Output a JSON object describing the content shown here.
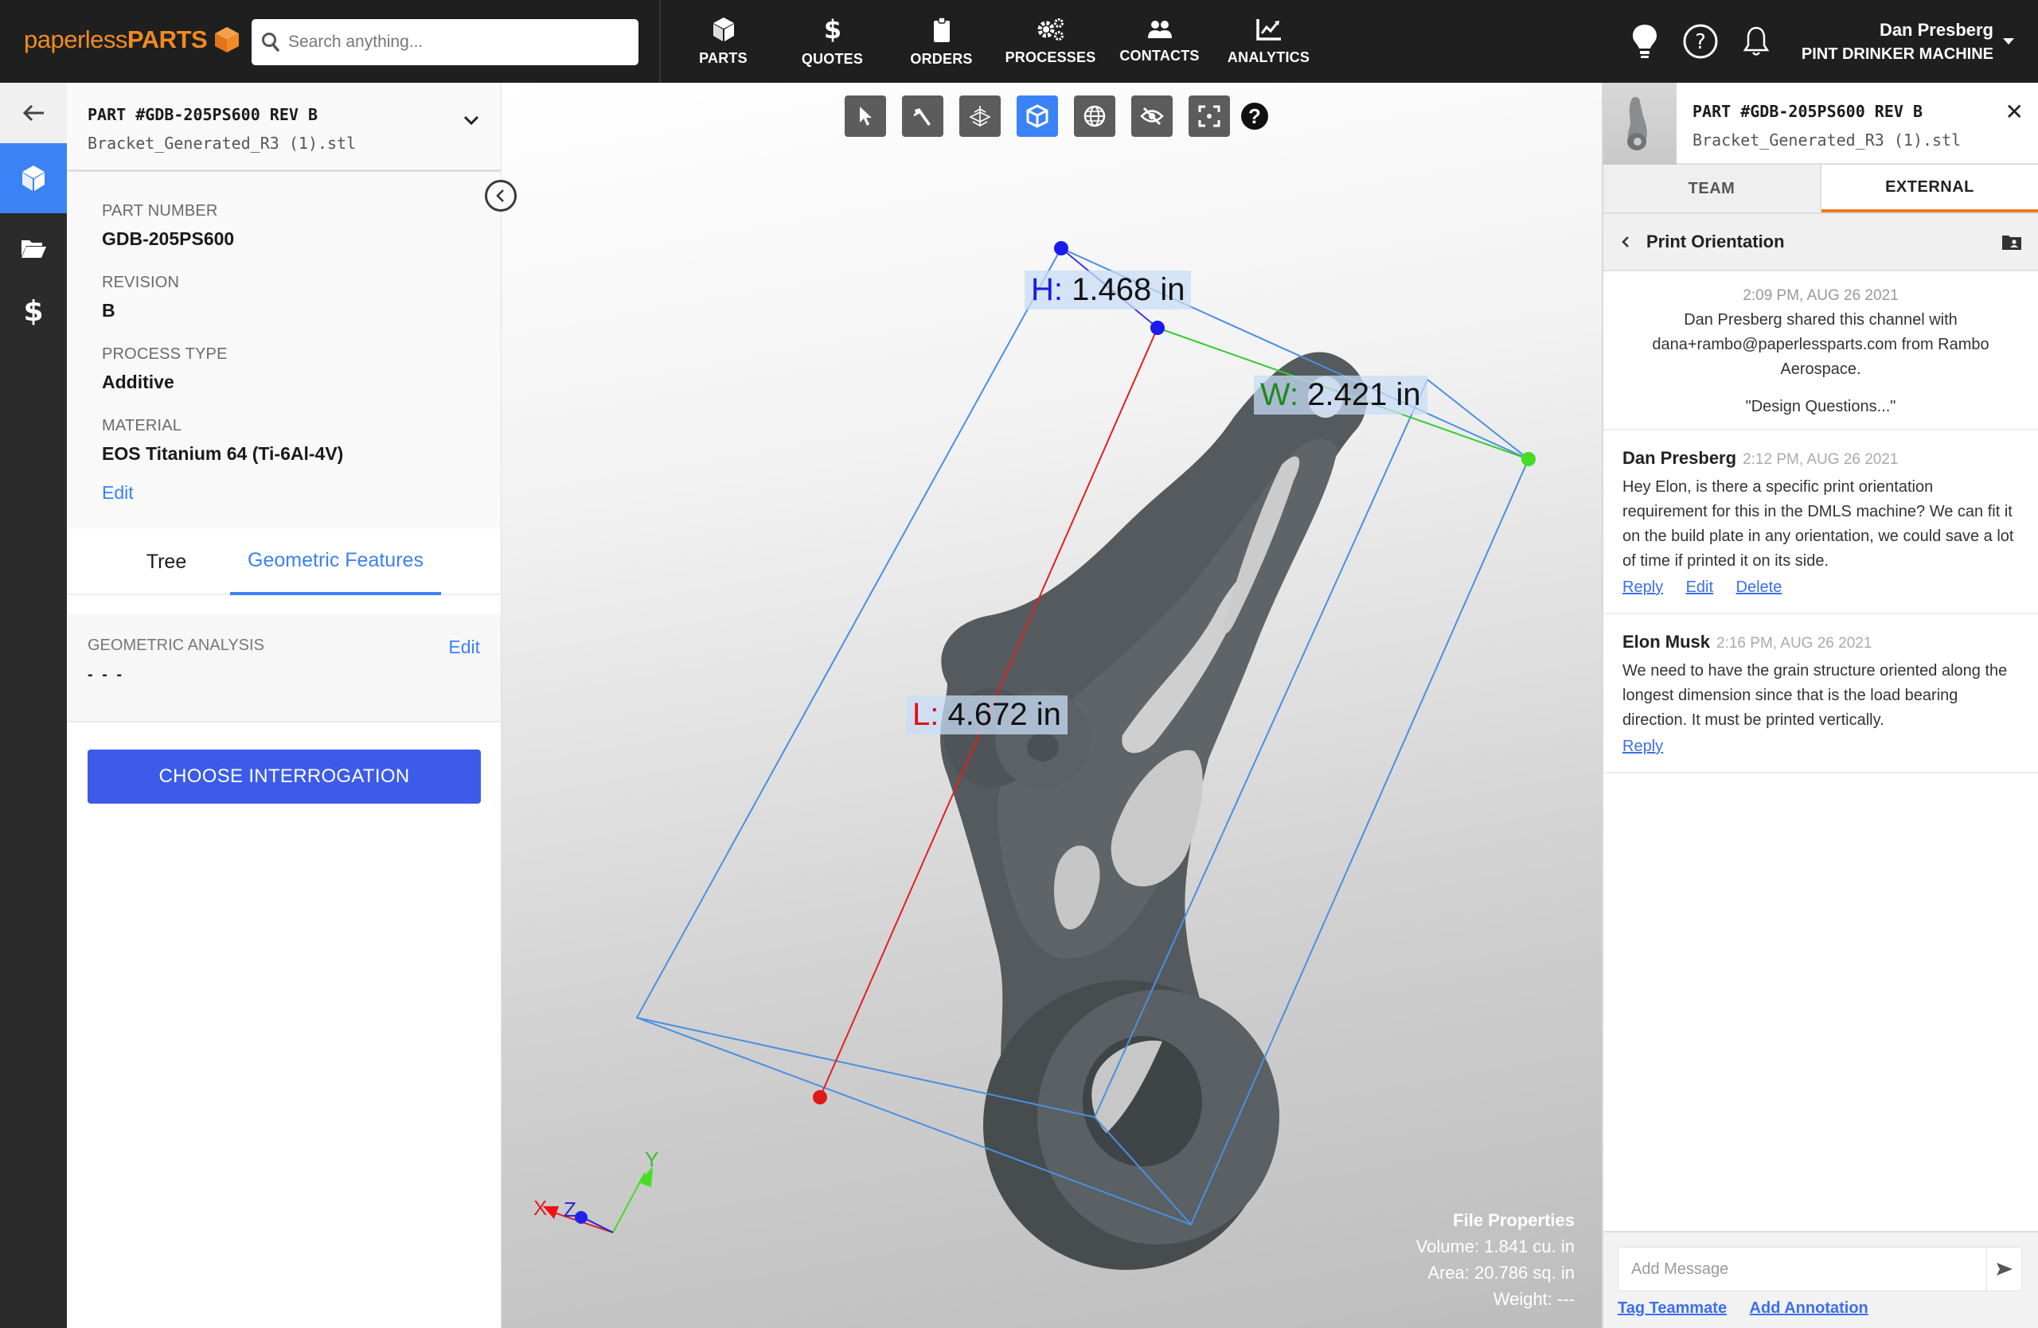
{
  "app": {
    "logo_light": "paperless",
    "logo_bold": "PARTS",
    "brand_color": "#f08a24",
    "accent_color": "#3b82f6"
  },
  "search": {
    "placeholder": "Search anything..."
  },
  "nav": [
    {
      "label": "PARTS",
      "icon": "cube-icon"
    },
    {
      "label": "QUOTES",
      "icon": "dollar-icon"
    },
    {
      "label": "ORDERS",
      "icon": "clipboard-icon"
    },
    {
      "label": "PROCESSES",
      "icon": "gears-icon"
    },
    {
      "label": "CONTACTS",
      "icon": "users-icon"
    },
    {
      "label": "ANALYTICS",
      "icon": "chart-icon"
    }
  ],
  "user": {
    "name": "Dan Presberg",
    "org": "PINT DRINKER MACHINE"
  },
  "left_panel": {
    "part_title": "PART #GDB-205PS600 REV B",
    "file_name": "Bracket_Generated_R3 (1).stl",
    "props": [
      {
        "key": "PART NUMBER",
        "value": "GDB-205PS600"
      },
      {
        "key": "REVISION",
        "value": "B"
      },
      {
        "key": "PROCESS TYPE",
        "value": "Additive"
      },
      {
        "key": "MATERIAL",
        "value": "EOS Titanium 64 (Ti-6Al-4V)"
      }
    ],
    "edit_label": "Edit",
    "tabs": {
      "tree": "Tree",
      "geometric": "Geometric Features"
    },
    "geometric_analysis": {
      "label": "GEOMETRIC ANALYSIS",
      "value": "- - -",
      "edit": "Edit"
    },
    "choose_button": "CHOOSE INTERROGATION"
  },
  "viewer": {
    "dimensions": {
      "height": {
        "prefix": "H:",
        "value": "1.468 in"
      },
      "width": {
        "prefix": "W:",
        "value": "2.421 in"
      },
      "length": {
        "prefix": "L:",
        "value": "4.672 in"
      }
    },
    "axes": {
      "x": "X",
      "y": "Y",
      "z": "Z"
    },
    "file_properties": {
      "title": "File Properties",
      "volume": "Volume: 1.841 cu. in",
      "area": "Area: 20.786 sq. in",
      "weight": "Weight: ---"
    },
    "toolbar_help": "?"
  },
  "right_panel": {
    "part_title": "PART #GDB-205PS600 REV B",
    "file_name": "Bracket_Generated_R3 (1).stl",
    "close": "✕",
    "tabs": {
      "team": "TEAM",
      "external": "EXTERNAL"
    },
    "channel": "Print Orientation",
    "system_message": {
      "timestamp": "2:09 PM, AUG 26 2021",
      "text": "Dan Presberg shared this channel with dana+rambo@paperlessparts.com from Rambo Aerospace.",
      "quote": "\"Design Questions...\""
    },
    "messages": [
      {
        "author": "Dan Presberg",
        "timestamp": "2:12 PM, AUG 26 2021",
        "body": "Hey Elon, is there a specific print orientation requirement for this in the DMLS machine? We can fit it on the build plate in any orientation, we could save a lot of time if printed it on its side.",
        "actions": [
          "Reply",
          "Edit",
          "Delete"
        ]
      },
      {
        "author": "Elon Musk",
        "timestamp": "2:16 PM, AUG 26 2021",
        "body": "We need to have the grain structure oriented along the longest dimension since that is the load bearing direction. It must be printed vertically.",
        "actions": [
          "Reply"
        ]
      }
    ],
    "composer": {
      "placeholder": "Add Message",
      "links": [
        "Tag Teammate",
        "Add Annotation"
      ]
    }
  }
}
